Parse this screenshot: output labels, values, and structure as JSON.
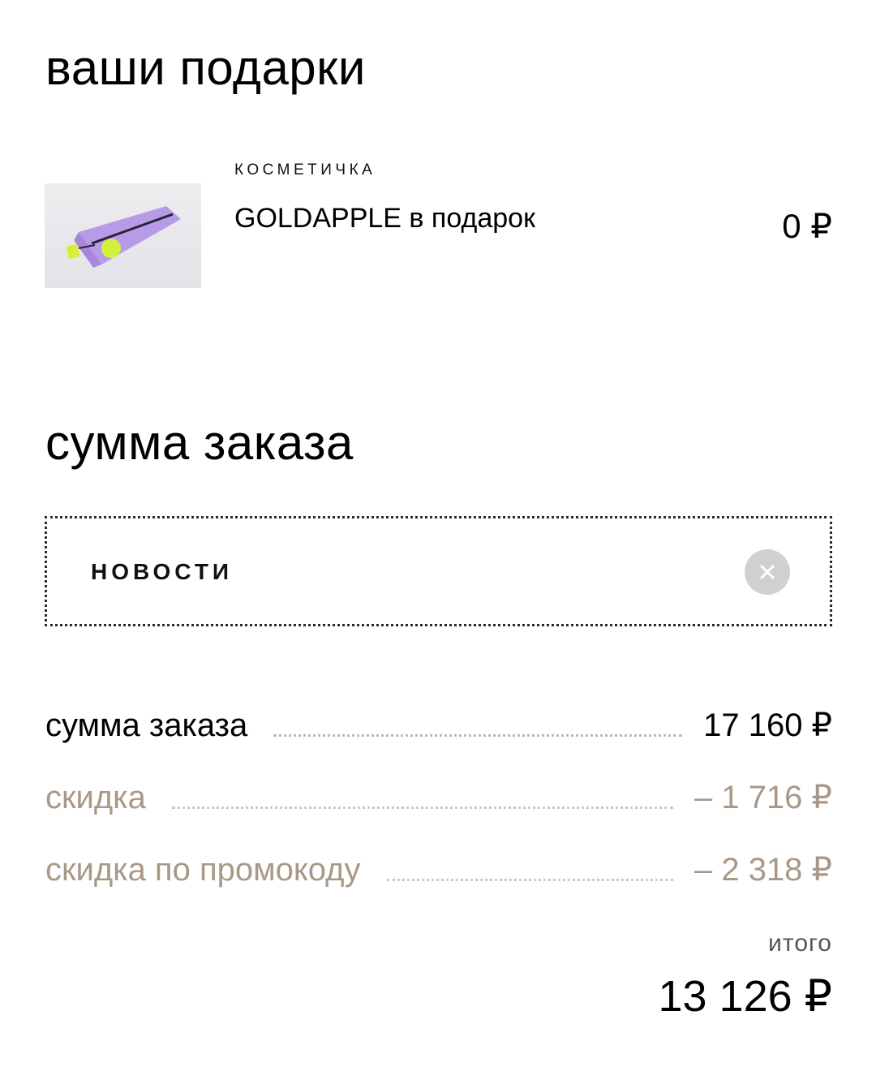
{
  "gifts": {
    "title": "ваши подарки",
    "item": {
      "category": "КОСМЕТИЧКА",
      "name": "GOLDAPPLE в подарок",
      "price": "0 ₽"
    }
  },
  "summary": {
    "title": "сумма заказа",
    "promo": {
      "code": "НОВОСТИ",
      "clear_icon": "close-icon"
    },
    "rows": [
      {
        "label": "сумма заказа",
        "value": "17 160 ₽"
      },
      {
        "label": "скидка",
        "value": "– 1 716 ₽"
      },
      {
        "label": "скидка по промокоду",
        "value": "– 2 318 ₽"
      }
    ],
    "total_label": "итого",
    "total_value": "13 126 ₽"
  },
  "colors": {
    "text": "#000000",
    "discount": "#a89887",
    "clear_button": "#d0d0d0",
    "bag": "#b89be8",
    "tag": "#d4f03c"
  }
}
